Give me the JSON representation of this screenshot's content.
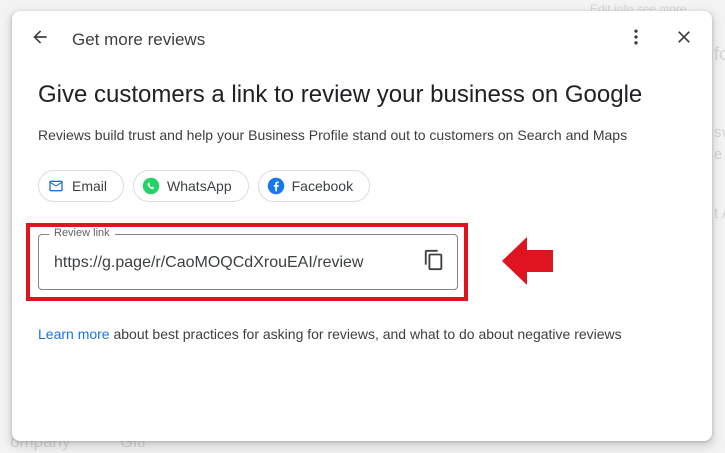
{
  "background": {
    "snippets": [
      "Edit info  see more",
      "fo",
      "sv",
      "e",
      "t A",
      "ompany",
      "Gitl"
    ]
  },
  "dialog": {
    "title": "Get more reviews",
    "heading": "Give customers a link to review your business on Google",
    "subtext": "Reviews build trust and help your Business Profile stand out to customers on Search and Maps",
    "share_options": [
      {
        "label": "Email",
        "icon": "email-icon",
        "color": "#1a73e8"
      },
      {
        "label": "WhatsApp",
        "icon": "whatsapp-icon",
        "color": "#25d366"
      },
      {
        "label": "Facebook",
        "icon": "facebook-icon",
        "color": "#1877f2"
      }
    ],
    "review_link": {
      "label": "Review link",
      "value": "https://g.page/r/CaoMOQCdXrouEAI/review"
    },
    "footer": {
      "link_text": "Learn more",
      "text": " about best practices for asking for reviews, and what to do about negative reviews"
    }
  },
  "annotation": {
    "highlight_color": "#e0141f"
  }
}
